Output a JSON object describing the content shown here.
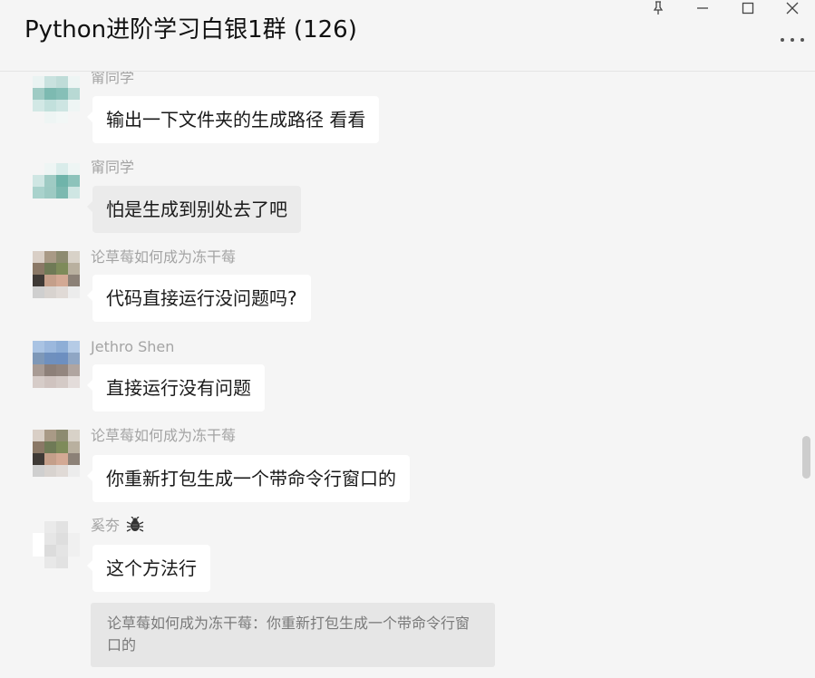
{
  "window": {
    "title": "Python进阶学习白银1群 (126)",
    "buttons": [
      "pin-icon",
      "minimize-icon",
      "maximize-icon",
      "close-icon",
      "more-icon"
    ]
  },
  "messages": [
    {
      "sender": "甯同学",
      "text": "输出一下文件夹的生成路径 看看",
      "bubble": "white"
    },
    {
      "sender": "甯同学",
      "text": "怕是生成到别处去了吧",
      "bubble": "grey"
    },
    {
      "sender": "论草莓如何成为冻干莓",
      "text": "代码直接运行没问题吗?",
      "bubble": "white"
    },
    {
      "sender": "Jethro Shen",
      "text": "直接运行没有问题",
      "bubble": "white"
    },
    {
      "sender": "论草莓如何成为冻干莓",
      "text": "你重新打包生成一个带命令行窗口的",
      "bubble": "white"
    },
    {
      "sender": "奚夯",
      "sender_badge": "bug-icon",
      "text": "这个方法行",
      "bubble": "white",
      "quote": "论草莓如何成为冻干莓：你重新打包生成一个带命令行窗口的"
    }
  ],
  "colors": {
    "background": "#f5f5f5",
    "bubble": "#ffffff",
    "bubble_grey": "#ebebeb",
    "sender": "#a4a4a4",
    "quote_bg": "#e6e6e6"
  }
}
